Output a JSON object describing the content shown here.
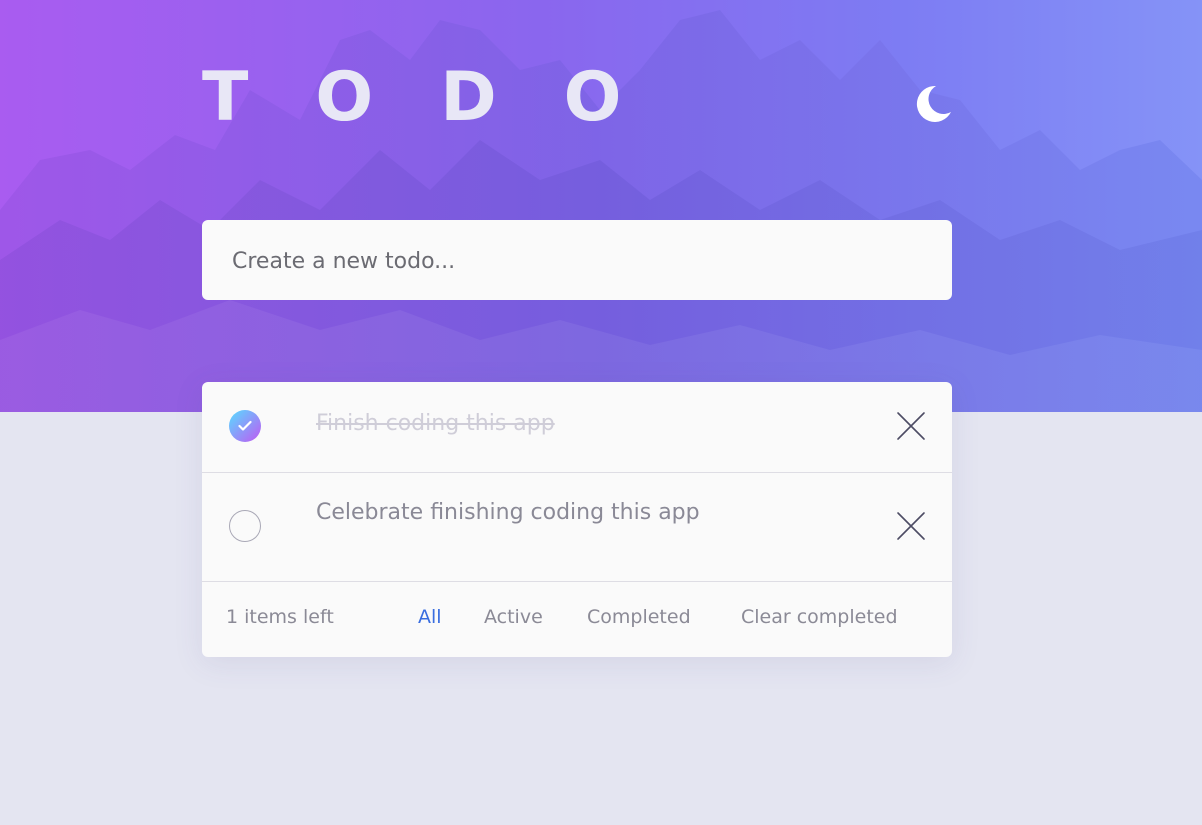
{
  "header": {
    "title": "TODO",
    "theme_icon": "moon-icon"
  },
  "new_todo": {
    "placeholder": "Create a new todo..."
  },
  "todos": [
    {
      "text": "Finish coding this app",
      "completed": true
    },
    {
      "text": "Celebrate finishing coding this app",
      "completed": false
    }
  ],
  "footer": {
    "items_left": "1 items left",
    "filters": [
      "All",
      "Active",
      "Completed"
    ],
    "active_filter": "All",
    "clear_label": "Clear completed"
  },
  "colors": {
    "accent": "#3a6ee0",
    "check_gradient_start": "#57ddff",
    "check_gradient_end": "#c058f3",
    "page_background": "#e4e5f1",
    "card_background": "#fafafa"
  }
}
